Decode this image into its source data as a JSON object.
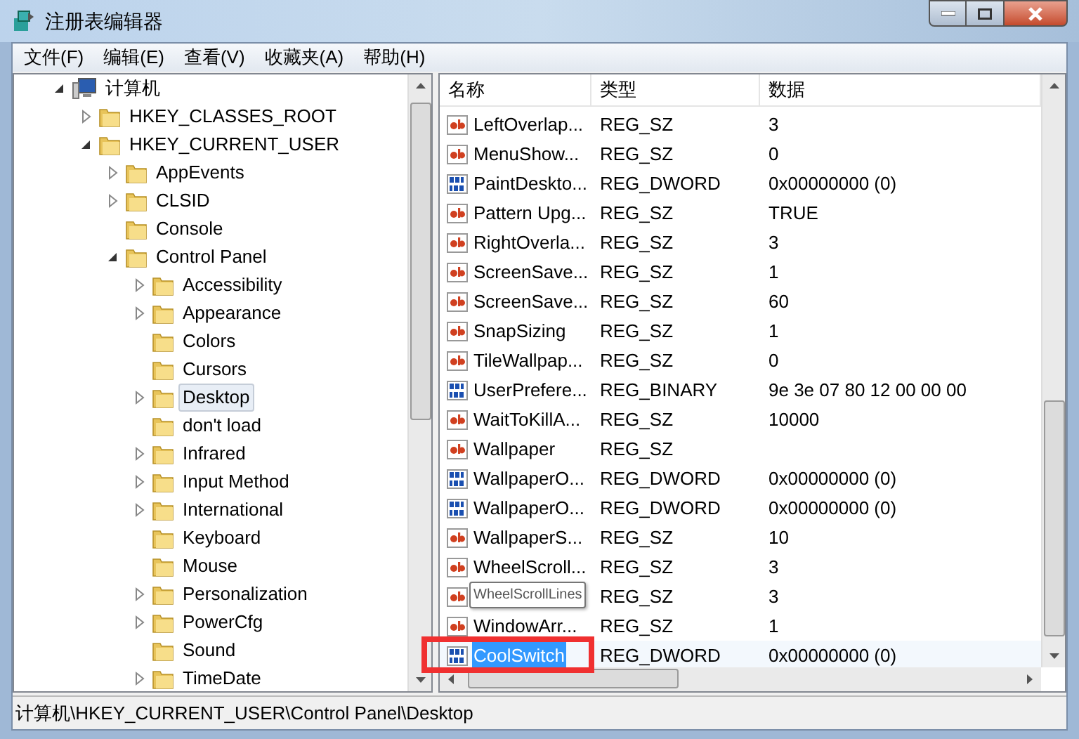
{
  "window": {
    "title": "注册表编辑器"
  },
  "menu": [
    "文件(F)",
    "编辑(E)",
    "查看(V)",
    "收藏夹(A)",
    "帮助(H)"
  ],
  "tree": [
    {
      "label": "计算机",
      "kind": "computer",
      "expanded": true,
      "selected": false,
      "children": [
        {
          "label": "HKEY_CLASSES_ROOT",
          "kind": "folder",
          "expanded": false,
          "selected": false,
          "has_children": true
        },
        {
          "label": "HKEY_CURRENT_USER",
          "kind": "folder",
          "expanded": true,
          "selected": false,
          "children": [
            {
              "label": "AppEvents",
              "kind": "folder",
              "expanded": false,
              "selected": false,
              "has_children": true
            },
            {
              "label": "CLSID",
              "kind": "folder",
              "expanded": false,
              "selected": false,
              "has_children": true
            },
            {
              "label": "Console",
              "kind": "folder",
              "expanded": false,
              "selected": false,
              "has_children": false
            },
            {
              "label": "Control Panel",
              "kind": "folder",
              "expanded": true,
              "selected": false,
              "children": [
                {
                  "label": "Accessibility",
                  "kind": "folder",
                  "expanded": false,
                  "selected": false,
                  "has_children": true
                },
                {
                  "label": "Appearance",
                  "kind": "folder",
                  "expanded": false,
                  "selected": false,
                  "has_children": true
                },
                {
                  "label": "Colors",
                  "kind": "folder",
                  "expanded": false,
                  "selected": false,
                  "has_children": false
                },
                {
                  "label": "Cursors",
                  "kind": "folder",
                  "expanded": false,
                  "selected": false,
                  "has_children": false
                },
                {
                  "label": "Desktop",
                  "kind": "folder",
                  "expanded": false,
                  "selected": true,
                  "has_children": true
                },
                {
                  "label": "don't load",
                  "kind": "folder",
                  "expanded": false,
                  "selected": false,
                  "has_children": false
                },
                {
                  "label": "Infrared",
                  "kind": "folder",
                  "expanded": false,
                  "selected": false,
                  "has_children": true
                },
                {
                  "label": "Input Method",
                  "kind": "folder",
                  "expanded": false,
                  "selected": false,
                  "has_children": true
                },
                {
                  "label": "International",
                  "kind": "folder",
                  "expanded": false,
                  "selected": false,
                  "has_children": true
                },
                {
                  "label": "Keyboard",
                  "kind": "folder",
                  "expanded": false,
                  "selected": false,
                  "has_children": false
                },
                {
                  "label": "Mouse",
                  "kind": "folder",
                  "expanded": false,
                  "selected": false,
                  "has_children": false
                },
                {
                  "label": "Personalization",
                  "kind": "folder",
                  "expanded": false,
                  "selected": false,
                  "has_children": true
                },
                {
                  "label": "PowerCfg",
                  "kind": "folder",
                  "expanded": false,
                  "selected": false,
                  "has_children": true
                },
                {
                  "label": "Sound",
                  "kind": "folder",
                  "expanded": false,
                  "selected": false,
                  "has_children": false
                },
                {
                  "label": "TimeDate",
                  "kind": "folder",
                  "expanded": false,
                  "selected": false,
                  "has_children": true
                }
              ]
            }
          ]
        }
      ]
    }
  ],
  "table": {
    "columns": [
      "名称",
      "类型",
      "数据"
    ],
    "rows": [
      {
        "kind": "string",
        "name": "LeftOverlap...",
        "type": "REG_SZ",
        "data": "3",
        "selected": false,
        "highlighted": false
      },
      {
        "kind": "string",
        "name": "MenuShow...",
        "type": "REG_SZ",
        "data": "0",
        "selected": false,
        "highlighted": false
      },
      {
        "kind": "binary",
        "name": "PaintDeskto...",
        "type": "REG_DWORD",
        "data": "0x00000000 (0)",
        "selected": false,
        "highlighted": false
      },
      {
        "kind": "string",
        "name": "Pattern Upg...",
        "type": "REG_SZ",
        "data": "TRUE",
        "selected": false,
        "highlighted": false
      },
      {
        "kind": "string",
        "name": "RightOverla...",
        "type": "REG_SZ",
        "data": "3",
        "selected": false,
        "highlighted": false
      },
      {
        "kind": "string",
        "name": "ScreenSave...",
        "type": "REG_SZ",
        "data": "1",
        "selected": false,
        "highlighted": false
      },
      {
        "kind": "string",
        "name": "ScreenSave...",
        "type": "REG_SZ",
        "data": "60",
        "selected": false,
        "highlighted": false
      },
      {
        "kind": "string",
        "name": "SnapSizing",
        "type": "REG_SZ",
        "data": "1",
        "selected": false,
        "highlighted": false
      },
      {
        "kind": "string",
        "name": "TileWallpap...",
        "type": "REG_SZ",
        "data": "0",
        "selected": false,
        "highlighted": false
      },
      {
        "kind": "binary",
        "name": "UserPrefere...",
        "type": "REG_BINARY",
        "data": "9e 3e 07 80 12 00 00 00",
        "selected": false,
        "highlighted": false
      },
      {
        "kind": "string",
        "name": "WaitToKillA...",
        "type": "REG_SZ",
        "data": "10000",
        "selected": false,
        "highlighted": false
      },
      {
        "kind": "string",
        "name": "Wallpaper",
        "type": "REG_SZ",
        "selected": false,
        "highlighted": false
      },
      {
        "kind": "binary",
        "name": "WallpaperO...",
        "type": "REG_DWORD",
        "data": "0x00000000 (0)",
        "selected": false,
        "highlighted": false
      },
      {
        "kind": "binary",
        "name": "WallpaperO...",
        "type": "REG_DWORD",
        "data": "0x00000000 (0)",
        "selected": false,
        "highlighted": false
      },
      {
        "kind": "string",
        "name": "WallpaperS...",
        "type": "REG_SZ",
        "data": "10",
        "selected": false,
        "highlighted": false
      },
      {
        "kind": "string",
        "name": "WheelScroll...",
        "type": "REG_SZ",
        "data": "3",
        "selected": false,
        "highlighted": false
      },
      {
        "kind": "string",
        "type": "REG_SZ",
        "data": "3",
        "selected": false,
        "highlighted": false,
        "tooltip": "WheelScrollLines"
      },
      {
        "kind": "string",
        "name": "WindowArr...",
        "type": "REG_SZ",
        "data": "1",
        "selected": false,
        "highlighted": false
      },
      {
        "kind": "binary",
        "name": "CoolSwitch",
        "type": "REG_DWORD",
        "data": "0x00000000 (0)",
        "selected": true,
        "highlighted": true
      }
    ]
  },
  "status_bar": "计算机\\HKEY_CURRENT_USER\\Control Panel\\Desktop"
}
